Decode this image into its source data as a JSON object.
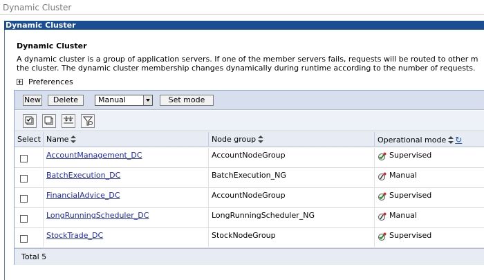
{
  "breadcrumb": "Dynamic Cluster",
  "panel_title": "Dynamic Cluster",
  "section_title": "Dynamic Cluster",
  "description_line1": "A dynamic cluster is a group of application servers. If one of the member servers fails, requests will be routed to other m",
  "description_line2": "the cluster. The dynamic cluster membership changes dynamically during runtime according to the number of requests.",
  "preferences_label": "Preferences",
  "toolbar": {
    "new_label": "New",
    "delete_label": "Delete",
    "mode_select_value": "Manual",
    "set_mode_label": "Set mode"
  },
  "icons": [
    "select-all-icon",
    "deselect-all-icon",
    "show-filter-icon",
    "clear-filter-icon"
  ],
  "columns": {
    "select": "Select",
    "name": "Name",
    "node_group": "Node group",
    "operational_mode": "Operational mode"
  },
  "rows": [
    {
      "name": "AccountManagement_DC",
      "node_group": "AccountNodeGroup",
      "mode": "Supervised"
    },
    {
      "name": "BatchExecution_DC",
      "node_group": "BatchExecution_NG",
      "mode": "Manual"
    },
    {
      "name": "FinancialAdvice_DC",
      "node_group": "AccountNodeGroup",
      "mode": "Supervised"
    },
    {
      "name": "LongRunningScheduler_DC",
      "node_group": "LongRunningScheduler_NG",
      "mode": "Manual"
    },
    {
      "name": "StockTrade_DC",
      "node_group": "StockNodeGroup",
      "mode": "Supervised"
    }
  ],
  "total_label": "Total 5",
  "colors": {
    "panel_bar": "#1a4d94",
    "toolbar_bg": "#d7dfee",
    "link": "#1f2bb0"
  }
}
